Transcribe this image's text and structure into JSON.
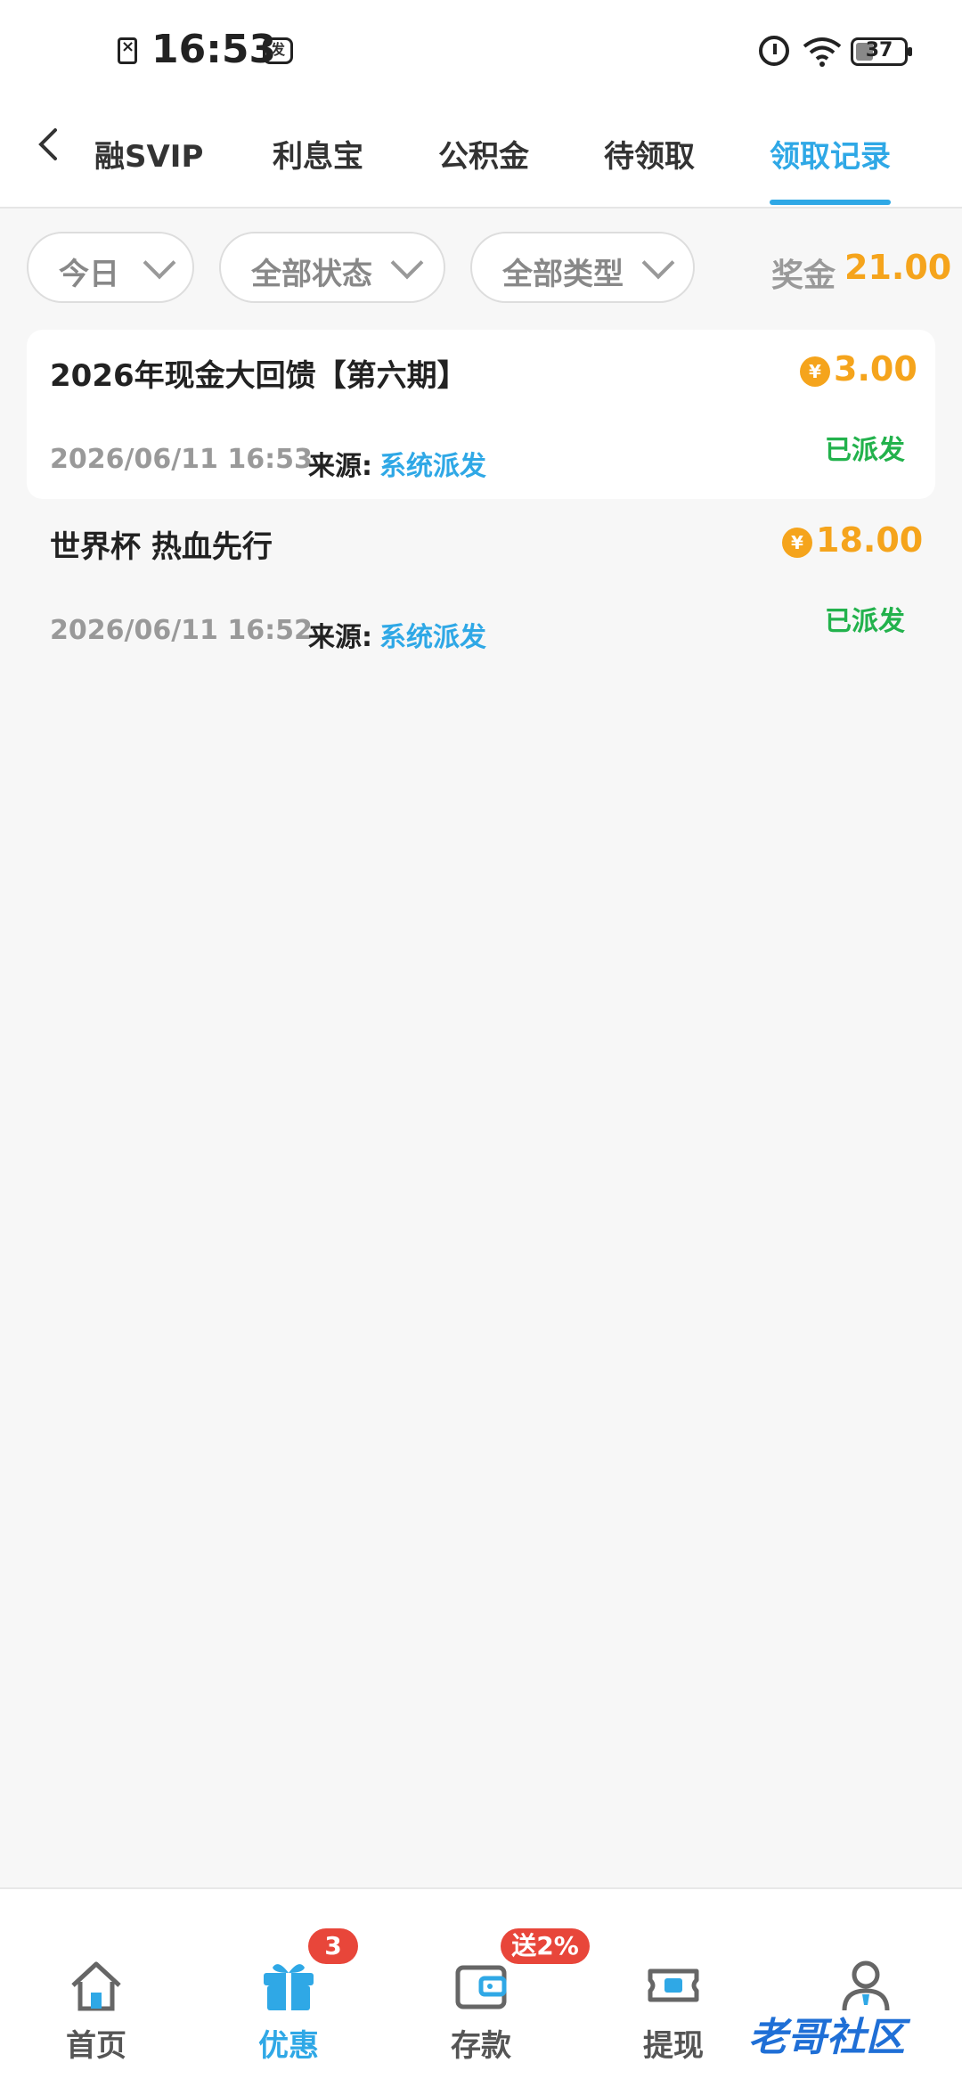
{
  "status_bar": {
    "time": "16:53",
    "battery": "37",
    "battery_level": 0.37
  },
  "tabs": [
    {
      "label": "融SVIP"
    },
    {
      "label": "利息宝"
    },
    {
      "label": "公积金"
    },
    {
      "label": "待领取"
    },
    {
      "label": "领取记录"
    }
  ],
  "filters": {
    "date": "今日",
    "status": "全部状态",
    "type": "全部类型"
  },
  "bonus": {
    "label": "奖金",
    "value": "21.00"
  },
  "records": [
    {
      "title": "2026年现金大回馈【第六期】",
      "coin": "¥",
      "amount": "3.00",
      "time": "2026/06/11 16:53",
      "source_label": "来源:",
      "source": "系统派发",
      "state": "已派发"
    },
    {
      "title": "世界杯 热血先行",
      "coin": "¥",
      "amount": "18.00",
      "time": "2026/06/11 16:52",
      "source_label": "来源:",
      "source": "系统派发",
      "state": "已派发"
    }
  ],
  "nav": [
    {
      "label": "首页"
    },
    {
      "label": "优惠",
      "badge": "3"
    },
    {
      "label": "存款",
      "badge": "送2%"
    },
    {
      "label": "提现"
    },
    {
      "label": ""
    }
  ],
  "watermark": "老哥社区",
  "colors": {
    "accent": "#2fa8e6",
    "gold": "#f5a41c",
    "green": "#22b24c",
    "badge": "#e8463a"
  }
}
